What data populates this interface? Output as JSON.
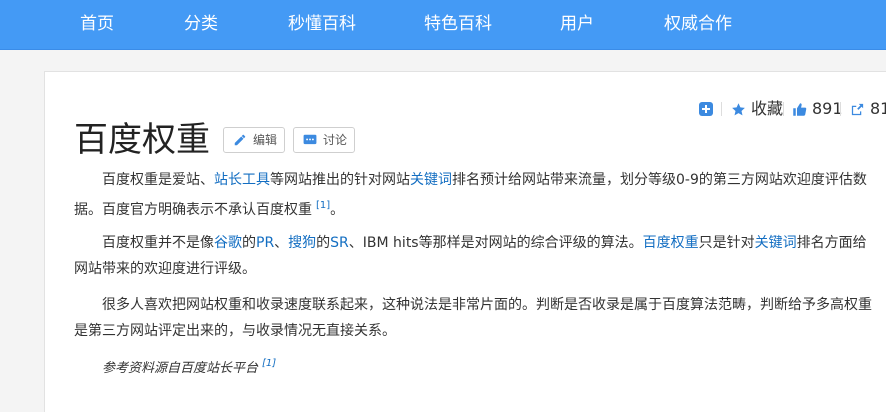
{
  "nav": {
    "items": [
      "首页",
      "分类",
      "秒懂百科",
      "特色百科",
      "用户",
      "权威合作"
    ]
  },
  "actions": {
    "collect_label": "收藏",
    "like_count": "891",
    "share_count": "81"
  },
  "article": {
    "title": "百度权重",
    "edit_label": "编辑",
    "discuss_label": "讨论",
    "p1": {
      "t1": "百度权重是爱站、",
      "l1": "站长工具",
      "t2": "等网站推出的针对网站",
      "l2": "关键词",
      "t3": "排名预计给网站带来流量，划分等级0-9的第三方网站欢迎度评估数据。百度官方明确表示不承认百度权重",
      "ref": "[1]",
      "t4": "。"
    },
    "p2": {
      "t1": "百度权重并不是像",
      "l1": "谷歌",
      "t2": "的",
      "l2": "PR",
      "t3": "、",
      "l3": "搜狗",
      "t4": "的",
      "l4": "SR",
      "t5": "、IBM hits等那样是对网站的综合评级的算法。",
      "l5": "百度权重",
      "t6": "只是针对",
      "l6": "关键词",
      "t7": "排名方面给网站带来的欢迎度进行评级。"
    },
    "p3": "很多人喜欢把网站权重和收录速度联系起来，这种说法是非常片面的。判断是否收录是属于百度算法范畴，判断给予多高权重是第三方网站评定出来的，与收录情况无直接关系。",
    "source_note": "参考资料源自百度站长平台",
    "source_ref": "[1]"
  },
  "colors": {
    "nav_bg": "#449af5",
    "link": "#136ec2",
    "icon_blue": "#3c8ae0"
  },
  "icons": [
    "plus-square-icon",
    "star-icon",
    "thumbs-up-icon",
    "share-icon",
    "pencil-icon",
    "chat-icon"
  ]
}
